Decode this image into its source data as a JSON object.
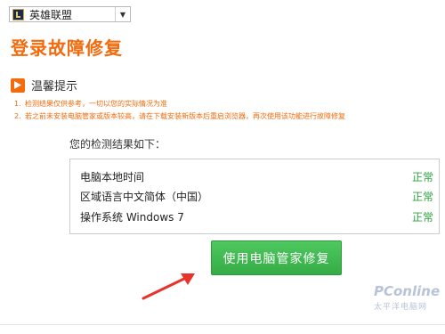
{
  "game_select": {
    "selected": "英雄联盟",
    "icon": "league-logo-icon"
  },
  "title": "登录故障修复",
  "tip": {
    "title": "温馨提示",
    "items": [
      {
        "num": "1.",
        "text": "检测结果仅供参考，一切以您的实际情况为准"
      },
      {
        "num": "2.",
        "text": "若之前未安装电脑管家或版本较高，请在下载安装新版本后重启浏览器，再次使用该功能进行故障修复"
      }
    ]
  },
  "results": {
    "heading": "您的检测结果如下：",
    "rows": [
      {
        "label": "电脑本地时间",
        "status": "正常"
      },
      {
        "label": "区域语言中文简体（中国）",
        "status": "正常"
      },
      {
        "label": "操作系统 Windows 7",
        "status": "正常"
      }
    ]
  },
  "repair_button": "使用电脑管家修复",
  "watermark": {
    "logo": "PConline",
    "sub": "太平洋电脑网"
  },
  "colors": {
    "accent": "#f36b0c",
    "ok": "#2ea341",
    "button": "#3cb64c"
  }
}
